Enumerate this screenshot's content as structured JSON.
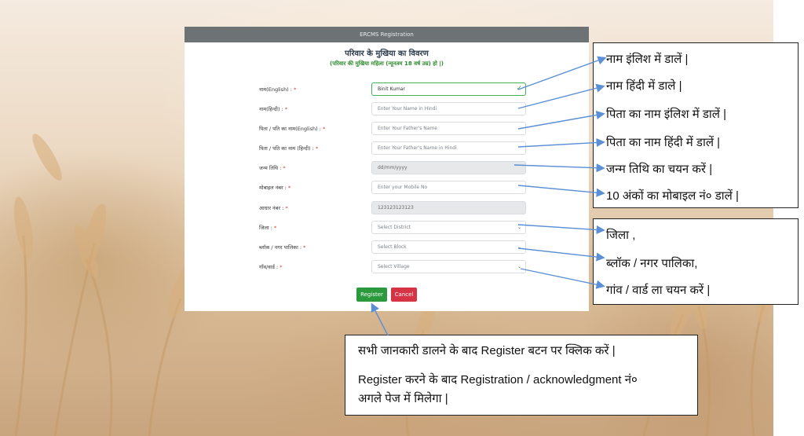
{
  "window": {
    "title": "ERCMS Registration"
  },
  "form": {
    "heading": "परिवार के मुखिया का विवरण",
    "subheading": "(परिवार की मुखिया महिला (न्यूनतम 18 वर्ष उम्र) हो |)",
    "required_mark": "*",
    "fields": [
      {
        "label": "नाम(English) :",
        "value": "Binit Kumar",
        "placeholder": ""
      },
      {
        "label": "नाम(हिन्दी) :",
        "value": "",
        "placeholder": "Enter Your Name in Hindi"
      },
      {
        "label": "पिता / पति का नाम(English) :",
        "value": "",
        "placeholder": "Enter Your Father's Name"
      },
      {
        "label": "पिता / पति का नाम (हिन्दी) :",
        "value": "",
        "placeholder": "Enter Your Father's Name in Hindi"
      },
      {
        "label": "जन्म तिथि :",
        "value": "",
        "placeholder": "dd/mm/yyyy"
      },
      {
        "label": "मोबाइल नंबर :",
        "value": "",
        "placeholder": "Enter your Mobile No"
      },
      {
        "label": "आधार नंबर :",
        "value": "123123123123",
        "placeholder": ""
      },
      {
        "label": "जिला :",
        "value": "Select District",
        "placeholder": ""
      },
      {
        "label": "ब्लॉक / नगर पालिका :",
        "value": "Select Block",
        "placeholder": ""
      },
      {
        "label": "गाँव/वार्ड :",
        "value": "Select Village",
        "placeholder": ""
      }
    ],
    "register_label": "Register",
    "cancel_label": "Cancel"
  },
  "callouts": {
    "c1": "नाम इंलिश में डालें |",
    "c2": "नाम हिंदी में डाले |",
    "c3": "पिता का नाम इंलिश में डालें |",
    "c4": "पिता का नाम हिंदी में डालें |",
    "c5": "जन्म तिथि का चयन करें |",
    "c6": "10 अंकों का मोबाइल नं० डालें |",
    "c7_line1": "जिला ,",
    "c7_line2": "ब्लॉक / नगर पालिका,",
    "c7_line3": "गांव / वार्ड ला चयन करें |",
    "c8_line1": "सभी जानकारी डालने के बाद Register बटन पर क्लिक करें |",
    "c8_line2": "Register करने के बाद Registration / acknowledgment नं०",
    "c8_line3": "अगले पेज में मिलेगा |"
  },
  "colors": {
    "header_bg": "#6d7275",
    "register_bg": "#2a9a3c",
    "cancel_bg": "#d63345",
    "subheading": "#2e8b2e",
    "arrow": "#5b8fd6"
  }
}
